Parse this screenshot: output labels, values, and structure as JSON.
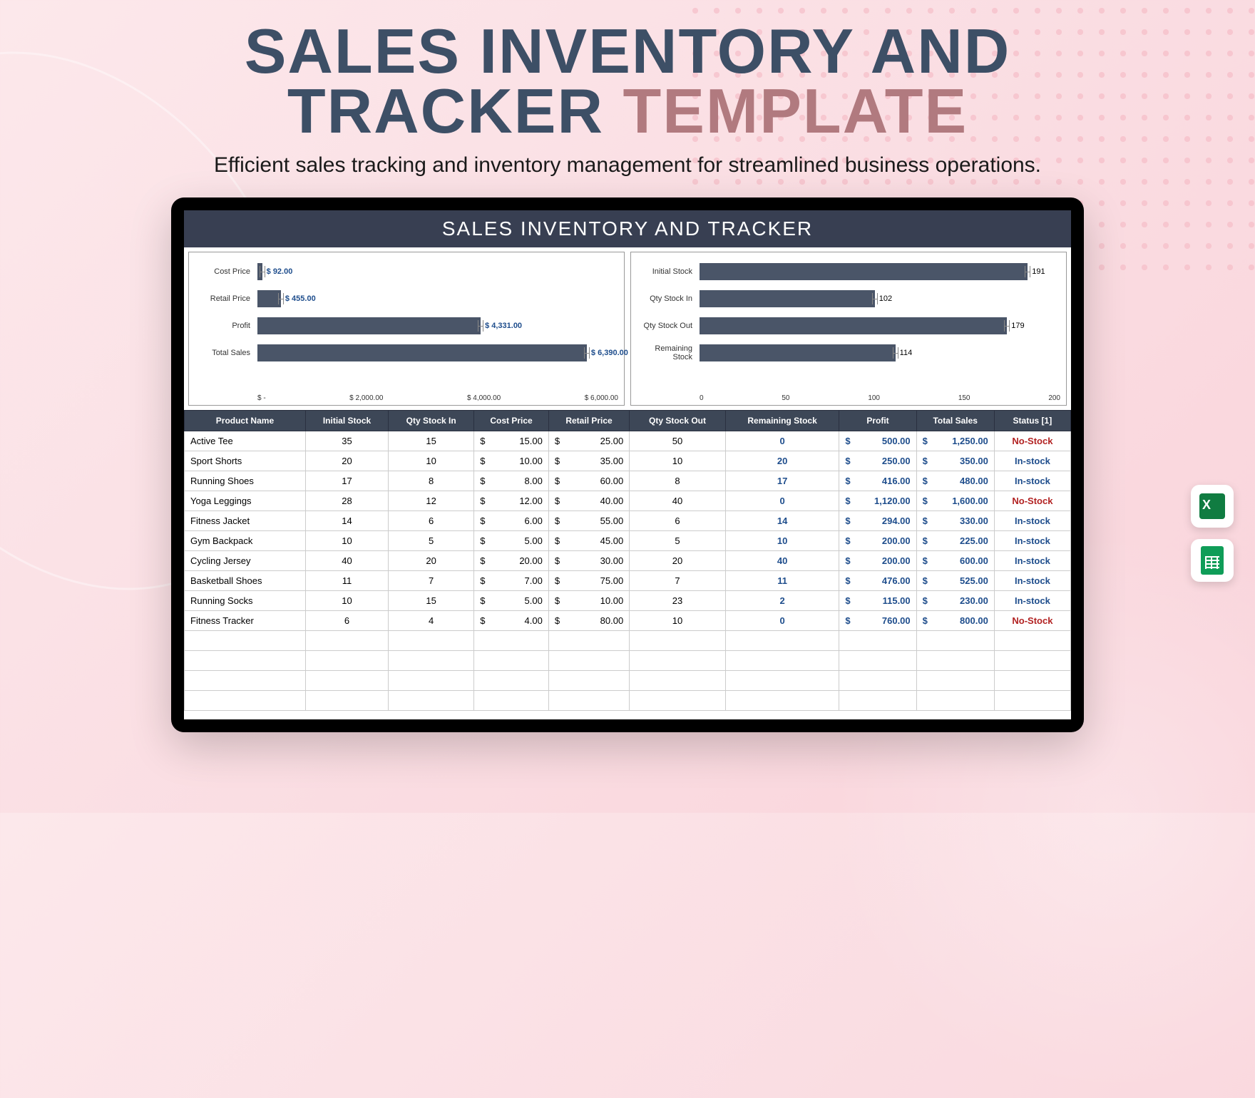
{
  "hero": {
    "title_line1": "SALES INVENTORY AND",
    "title_line2a": "TRACKER",
    "title_line2b": "TEMPLATE",
    "subtitle": "Efficient sales tracking and inventory management for streamlined business operations."
  },
  "app": {
    "header": "SALES INVENTORY AND TRACKER"
  },
  "chart_data": [
    {
      "type": "bar",
      "orientation": "horizontal",
      "categories": [
        "Cost Price",
        "Retail Price",
        "Profit",
        "Total Sales"
      ],
      "values": [
        92.0,
        455.0,
        4331.0,
        6390.0
      ],
      "value_labels": [
        "$ 92.00",
        "$ 455.00",
        "$ 4,331.00",
        "$ 6,390.00"
      ],
      "axis_ticks": [
        "$ -",
        "$ 2,000.00",
        "$ 4,000.00",
        "$ 6,000.00"
      ],
      "xlim": [
        0,
        7000
      ]
    },
    {
      "type": "bar",
      "orientation": "horizontal",
      "categories": [
        "Initial Stock",
        "Qty Stock In",
        "Qty Stock Out",
        "Remaining Stock"
      ],
      "values": [
        191,
        102,
        179,
        114
      ],
      "value_labels": [
        "191",
        "102",
        "179",
        "114"
      ],
      "axis_ticks": [
        "0",
        "50",
        "100",
        "150",
        "200"
      ],
      "xlim": [
        0,
        210
      ]
    }
  ],
  "table": {
    "headers": [
      "Product Name",
      "Initial Stock",
      "Qty Stock In",
      "Cost Price",
      "Retail Price",
      "Qty Stock Out",
      "Remaining Stock",
      "Profit",
      "Total Sales",
      "Status [1]"
    ],
    "rows": [
      {
        "name": "Active Tee",
        "init": "35",
        "qin": "15",
        "cost": "15.00",
        "retail": "25.00",
        "qout": "50",
        "remain": "0",
        "profit": "500.00",
        "total": "1,250.00",
        "status": "No-Stock"
      },
      {
        "name": "Sport Shorts",
        "init": "20",
        "qin": "10",
        "cost": "10.00",
        "retail": "35.00",
        "qout": "10",
        "remain": "20",
        "profit": "250.00",
        "total": "350.00",
        "status": "In-stock"
      },
      {
        "name": "Running Shoes",
        "init": "17",
        "qin": "8",
        "cost": "8.00",
        "retail": "60.00",
        "qout": "8",
        "remain": "17",
        "profit": "416.00",
        "total": "480.00",
        "status": "In-stock"
      },
      {
        "name": "Yoga Leggings",
        "init": "28",
        "qin": "12",
        "cost": "12.00",
        "retail": "40.00",
        "qout": "40",
        "remain": "0",
        "profit": "1,120.00",
        "total": "1,600.00",
        "status": "No-Stock"
      },
      {
        "name": "Fitness Jacket",
        "init": "14",
        "qin": "6",
        "cost": "6.00",
        "retail": "55.00",
        "qout": "6",
        "remain": "14",
        "profit": "294.00",
        "total": "330.00",
        "status": "In-stock"
      },
      {
        "name": "Gym Backpack",
        "init": "10",
        "qin": "5",
        "cost": "5.00",
        "retail": "45.00",
        "qout": "5",
        "remain": "10",
        "profit": "200.00",
        "total": "225.00",
        "status": "In-stock"
      },
      {
        "name": "Cycling Jersey",
        "init": "40",
        "qin": "20",
        "cost": "20.00",
        "retail": "30.00",
        "qout": "20",
        "remain": "40",
        "profit": "200.00",
        "total": "600.00",
        "status": "In-stock"
      },
      {
        "name": "Basketball Shoes",
        "init": "11",
        "qin": "7",
        "cost": "7.00",
        "retail": "75.00",
        "qout": "7",
        "remain": "11",
        "profit": "476.00",
        "total": "525.00",
        "status": "In-stock"
      },
      {
        "name": "Running Socks",
        "init": "10",
        "qin": "15",
        "cost": "5.00",
        "retail": "10.00",
        "qout": "23",
        "remain": "2",
        "profit": "115.00",
        "total": "230.00",
        "status": "In-stock"
      },
      {
        "name": "Fitness Tracker",
        "init": "6",
        "qin": "4",
        "cost": "4.00",
        "retail": "80.00",
        "qout": "10",
        "remain": "0",
        "profit": "760.00",
        "total": "800.00",
        "status": "No-Stock"
      }
    ]
  },
  "badges": {
    "excel": "excel-icon",
    "sheets": "sheets-icon"
  }
}
